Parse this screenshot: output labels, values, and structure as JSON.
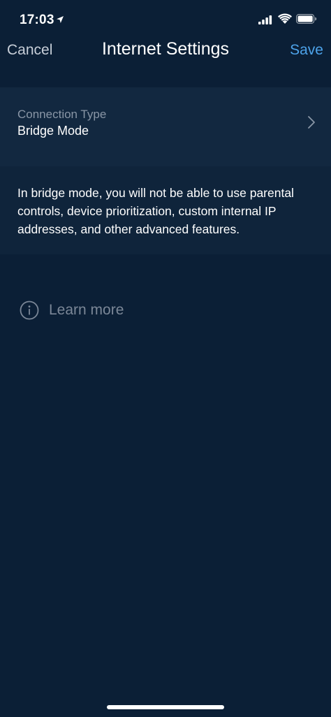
{
  "status_bar": {
    "time": "17:03"
  },
  "nav": {
    "cancel_label": "Cancel",
    "title": "Internet Settings",
    "save_label": "Save"
  },
  "connection": {
    "label": "Connection Type",
    "value": "Bridge Mode"
  },
  "info": {
    "text": "In bridge mode, you will not be able to use parental controls, device prioritization, custom internal IP addresses, and other advanced features."
  },
  "learn_more": {
    "label": "Learn more"
  },
  "colors": {
    "background": "#0b1f36",
    "row_background": "#122840",
    "accent": "#4da3ea",
    "secondary_text": "#8996a6"
  }
}
